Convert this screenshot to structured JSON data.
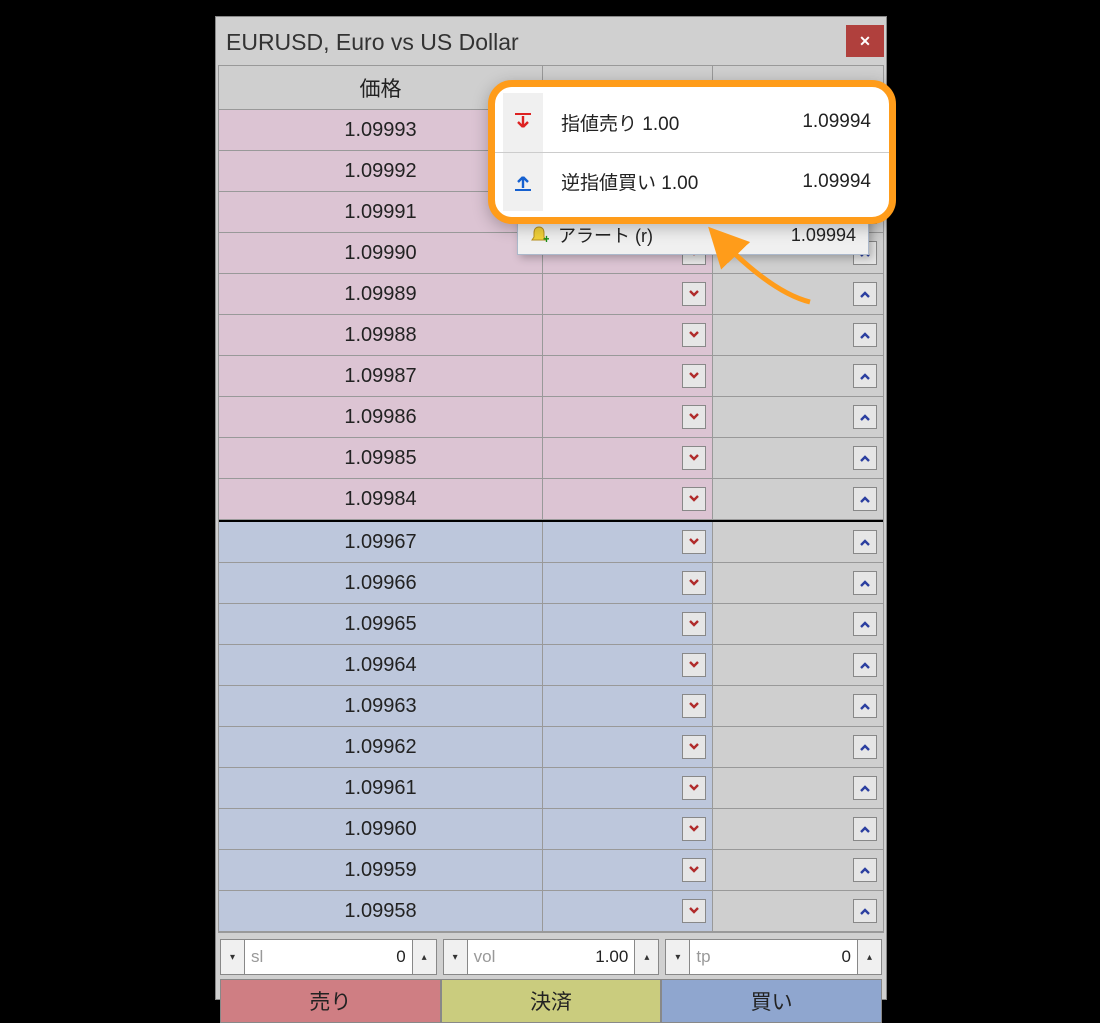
{
  "titlebar": {
    "title": "EURUSD, Euro vs US Dollar"
  },
  "header": {
    "price_label": "価格"
  },
  "rows_sell": [
    {
      "price": "1.09993"
    },
    {
      "price": "1.09992"
    },
    {
      "price": "1.09991"
    },
    {
      "price": "1.09990"
    },
    {
      "price": "1.09989"
    },
    {
      "price": "1.09988"
    },
    {
      "price": "1.09987"
    },
    {
      "price": "1.09986"
    },
    {
      "price": "1.09985"
    },
    {
      "price": "1.09984"
    }
  ],
  "rows_buy": [
    {
      "price": "1.09967"
    },
    {
      "price": "1.09966"
    },
    {
      "price": "1.09965"
    },
    {
      "price": "1.09964"
    },
    {
      "price": "1.09963"
    },
    {
      "price": "1.09962"
    },
    {
      "price": "1.09961"
    },
    {
      "price": "1.09960"
    },
    {
      "price": "1.09959"
    },
    {
      "price": "1.09958"
    }
  ],
  "inputs": {
    "sl": {
      "label": "sl",
      "value": "0"
    },
    "vol": {
      "label": "vol",
      "value": "1.00"
    },
    "tp": {
      "label": "tp",
      "value": "0"
    }
  },
  "actions": {
    "sell": "売り",
    "settle": "決済",
    "buy": "買い"
  },
  "context_menu": {
    "alert_label": "アラート (r)",
    "alert_price": "1.09994"
  },
  "callout": {
    "limit_sell_label": "指値売り 1.00",
    "limit_sell_price": "1.09994",
    "stop_buy_label": "逆指値買い 1.00",
    "stop_buy_price": "1.09994"
  }
}
